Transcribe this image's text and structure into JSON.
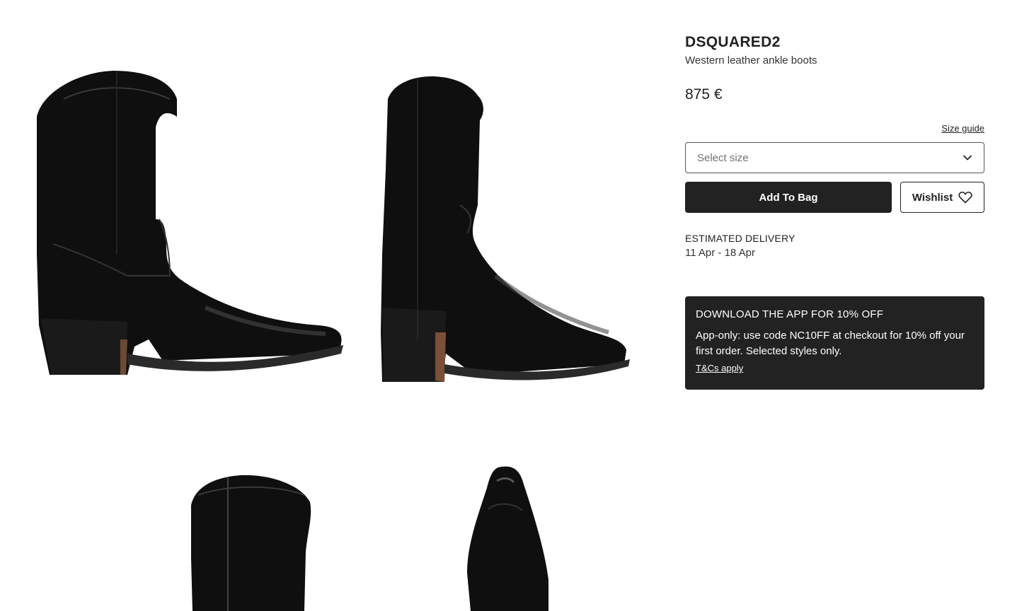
{
  "product": {
    "brand": "DSQUARED2",
    "name": "Western leather ankle boots",
    "price": "875 €"
  },
  "size": {
    "guide_label": "Size guide",
    "select_placeholder": "Select size"
  },
  "actions": {
    "add_to_bag_label": "Add To Bag",
    "wishlist_label": "Wishlist"
  },
  "delivery": {
    "label": "ESTIMATED DELIVERY",
    "dates": "11 Apr - 18 Apr"
  },
  "promo": {
    "title": "DOWNLOAD THE APP FOR 10% OFF",
    "text": "App-only: use code NC10FF at checkout for 10% off your first order. Selected styles only.",
    "link_label": "T&Cs apply"
  },
  "gallery": {
    "images": [
      {
        "alt": "boot-side-view"
      },
      {
        "alt": "boot-three-quarter-view"
      },
      {
        "alt": "boot-back-view"
      },
      {
        "alt": "boot-top-view"
      }
    ]
  },
  "colors": {
    "dark": "#222222",
    "background": "#ffffff",
    "placeholder": "#727272"
  }
}
